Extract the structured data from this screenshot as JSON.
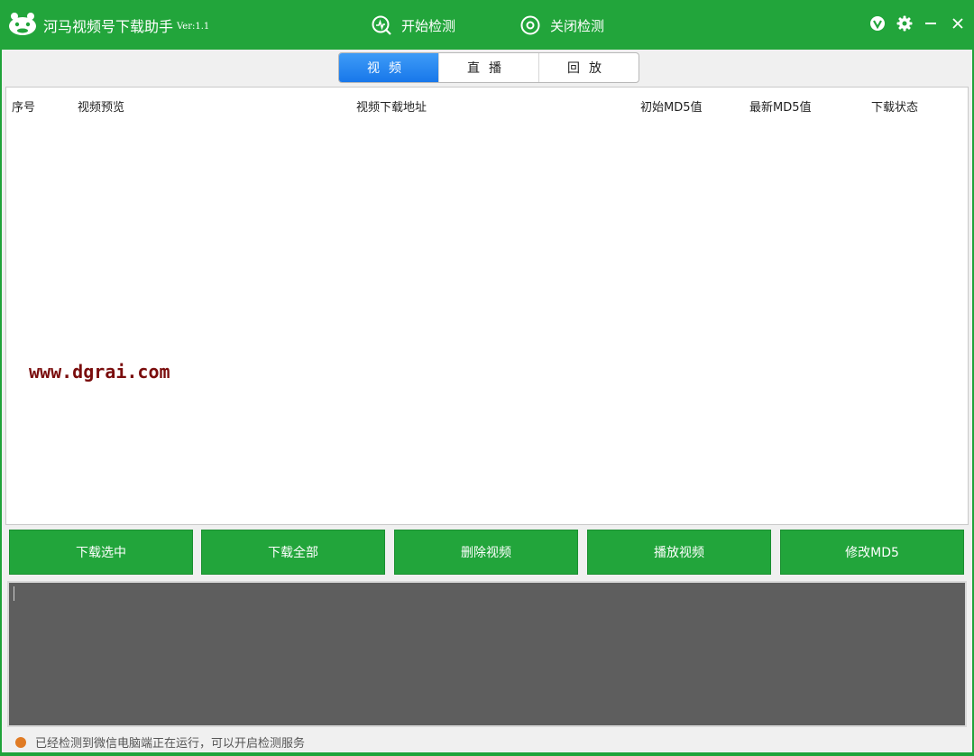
{
  "app": {
    "title": "河马视频号下载助手",
    "version": "Ver:1.1"
  },
  "toolbar": {
    "start_label": "开始检测",
    "stop_label": "关闭检测"
  },
  "tabs": [
    {
      "label": "视频",
      "active": true
    },
    {
      "label": "直播",
      "active": false
    },
    {
      "label": "回放",
      "active": false
    }
  ],
  "table": {
    "columns": [
      "序号",
      "视频预览",
      "视频下载地址",
      "初始MD5值",
      "最新MD5值",
      "下载状态"
    ],
    "rows": []
  },
  "watermark": "www.dgrai.com",
  "actions": {
    "download_selected": "下载选中",
    "download_all": "下载全部",
    "delete_video": "删除视频",
    "play_video": "播放视频",
    "modify_md5": "修改MD5"
  },
  "log": {
    "text": ""
  },
  "status": {
    "text": "已经检测到微信电脑端正在运行，可以开启检测服务",
    "indicator_color": "#e07b24"
  },
  "colors": {
    "brand_green": "#22a53b",
    "tab_active_blue": "#1877ea",
    "log_background": "#5e5e5e"
  },
  "icons": [
    "app-logo-icon",
    "monitor-start-icon",
    "stop-circle-icon",
    "vip-badge-icon",
    "gear-icon",
    "minimize-icon",
    "close-icon"
  ]
}
